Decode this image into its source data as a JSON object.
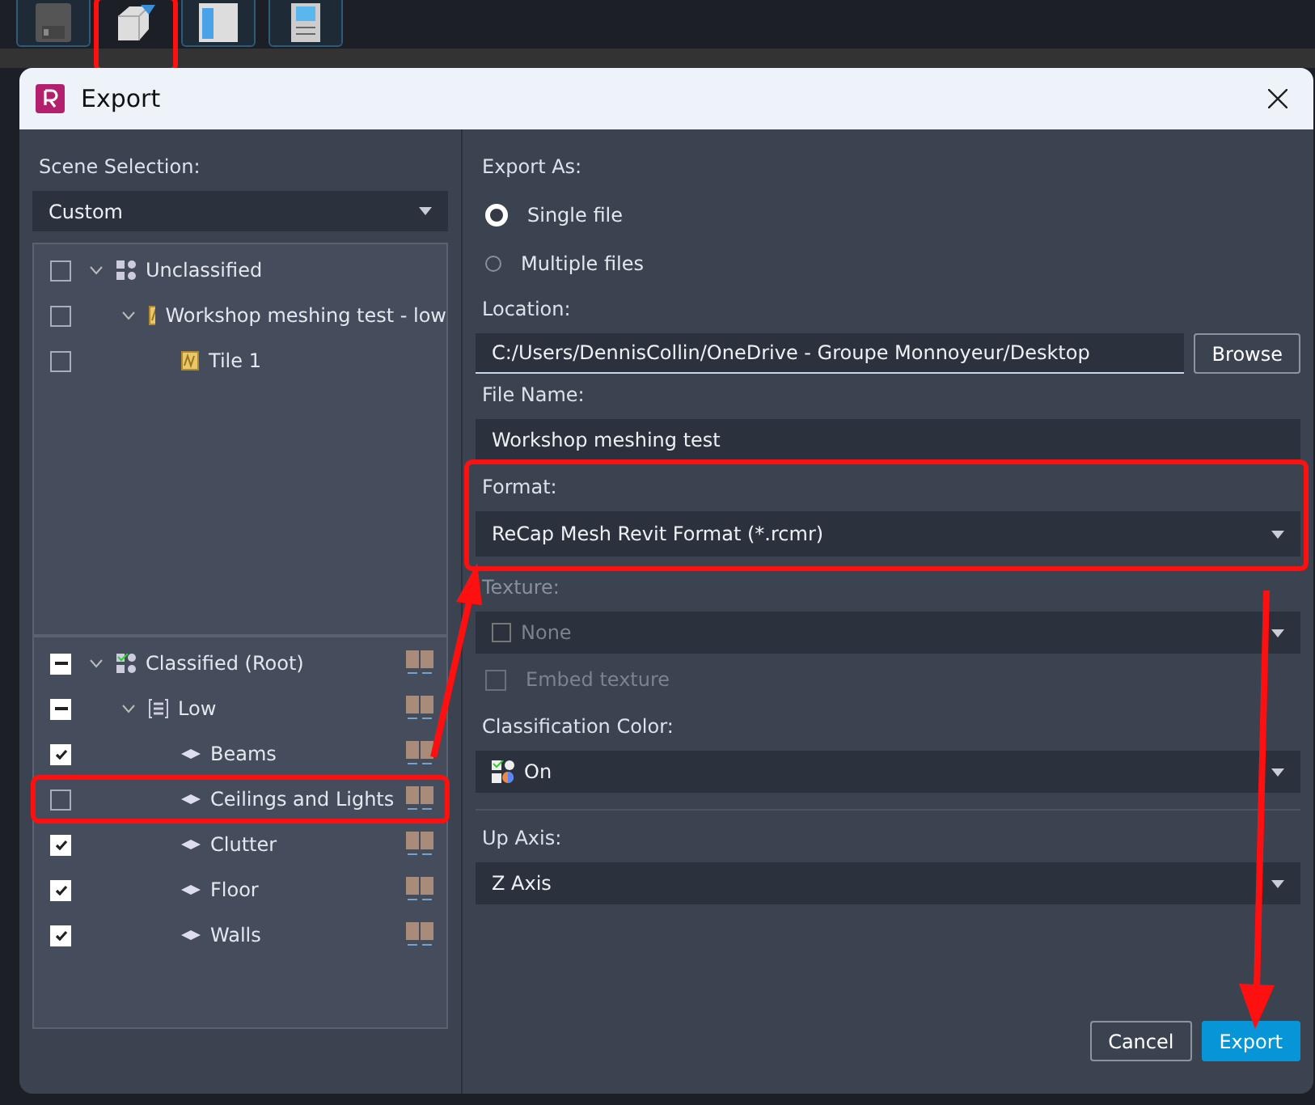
{
  "toolbar": {
    "buttons": [
      {
        "kind": "save"
      },
      {
        "kind": "export",
        "annotated": true
      },
      {
        "kind": "panel"
      },
      {
        "kind": "settings"
      }
    ]
  },
  "dialog": {
    "title": "Export",
    "scene_selection": {
      "label": "Scene Selection:",
      "value": "Custom"
    },
    "trees": [
      {
        "items": [
          {
            "label": "Unclassified",
            "kind": "group",
            "checked": false,
            "expanded": true,
            "children": [
              {
                "label": "Workshop meshing test - low",
                "kind": "tile",
                "checked": false,
                "expanded": true,
                "children": [
                  {
                    "label": "Tile 1",
                    "kind": "tile",
                    "checked": false
                  }
                ]
              }
            ]
          }
        ]
      },
      {
        "items": [
          {
            "label": "Classified (Root)",
            "kind": "classified",
            "indeterminate": true,
            "expanded": true,
            "children": [
              {
                "label": "Low",
                "kind": "layer",
                "indeterminate": true,
                "expanded": true,
                "children": [
                  {
                    "label": "Beams",
                    "kind": "class",
                    "checked": true
                  },
                  {
                    "label": "Ceilings and Lights",
                    "kind": "class",
                    "checked": false,
                    "annotated": true
                  },
                  {
                    "label": "Clutter",
                    "kind": "class",
                    "checked": true
                  },
                  {
                    "label": "Floor",
                    "kind": "class",
                    "checked": true
                  },
                  {
                    "label": "Walls",
                    "kind": "class",
                    "checked": true
                  }
                ]
              }
            ]
          }
        ]
      }
    ],
    "export_as": {
      "label": "Export As:",
      "options": [
        {
          "label": "Single file",
          "selected": true
        },
        {
          "label": "Multiple files",
          "selected": false
        }
      ]
    },
    "location": {
      "label": "Location:",
      "value": "C:/Users/DennisCollin/OneDrive - Groupe Monnoyeur/Desktop",
      "browse": "Browse"
    },
    "file_name": {
      "label": "File Name:",
      "value": "Workshop meshing test"
    },
    "format": {
      "label": "Format:",
      "value": "ReCap Mesh Revit Format (*.rcmr)",
      "annotated": true
    },
    "texture": {
      "label": "Texture:",
      "value": "None",
      "disabled": true
    },
    "embed_texture": {
      "label": "Embed texture",
      "checked": false,
      "disabled": true
    },
    "classification_color": {
      "label": "Classification Color:",
      "value": "On"
    },
    "up_axis": {
      "label": "Up Axis:",
      "value": "Z Axis"
    },
    "buttons": [
      {
        "label": "Cancel",
        "primary": false
      },
      {
        "label": "Export",
        "primary": true
      }
    ]
  }
}
